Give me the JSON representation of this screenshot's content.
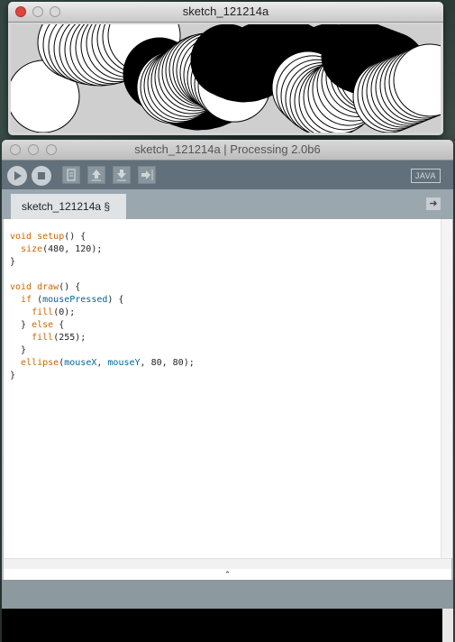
{
  "sketch_window": {
    "title": "sketch_121214a"
  },
  "ide_window": {
    "title": "sketch_121214a | Processing 2.0b6",
    "mode_label": "JAVA",
    "tab_label": "sketch_121214a §",
    "code_lines": [
      [
        {
          "t": "void ",
          "c": "kw"
        },
        {
          "t": "setup",
          "c": "kw"
        },
        {
          "t": "() {",
          "c": ""
        }
      ],
      [
        {
          "t": "  ",
          "c": ""
        },
        {
          "t": "size",
          "c": "kw"
        },
        {
          "t": "(480, 120);",
          "c": ""
        }
      ],
      [
        {
          "t": "}",
          "c": ""
        }
      ],
      [
        {
          "t": "",
          "c": ""
        }
      ],
      [
        {
          "t": "void ",
          "c": "kw"
        },
        {
          "t": "draw",
          "c": "kw"
        },
        {
          "t": "() {",
          "c": ""
        }
      ],
      [
        {
          "t": "  ",
          "c": ""
        },
        {
          "t": "if",
          "c": "kw"
        },
        {
          "t": " (",
          "c": ""
        },
        {
          "t": "mousePressed",
          "c": "var"
        },
        {
          "t": ") {",
          "c": ""
        }
      ],
      [
        {
          "t": "    ",
          "c": ""
        },
        {
          "t": "fill",
          "c": "kw"
        },
        {
          "t": "(0);",
          "c": ""
        }
      ],
      [
        {
          "t": "  } ",
          "c": ""
        },
        {
          "t": "else",
          "c": "kw"
        },
        {
          "t": " {",
          "c": ""
        }
      ],
      [
        {
          "t": "    ",
          "c": ""
        },
        {
          "t": "fill",
          "c": "kw"
        },
        {
          "t": "(255);",
          "c": ""
        }
      ],
      [
        {
          "t": "  }",
          "c": ""
        }
      ],
      [
        {
          "t": "  ",
          "c": ""
        },
        {
          "t": "ellipse",
          "c": "kw"
        },
        {
          "t": "(",
          "c": ""
        },
        {
          "t": "mouseX",
          "c": "var"
        },
        {
          "t": ", ",
          "c": ""
        },
        {
          "t": "mouseY",
          "c": "var"
        },
        {
          "t": ", 80, 80);",
          "c": ""
        }
      ],
      [
        {
          "t": "}",
          "c": ""
        }
      ]
    ],
    "divider_glyph": "⌃"
  },
  "colors": {
    "keyword": "#cc6600",
    "variable": "#006699",
    "toolbar": "#61707a"
  },
  "icons": [
    "close-icon",
    "minimize-icon",
    "zoom-icon",
    "run-icon",
    "stop-icon",
    "new-icon",
    "open-icon",
    "save-icon",
    "export-icon",
    "tab-menu-arrow-icon"
  ]
}
